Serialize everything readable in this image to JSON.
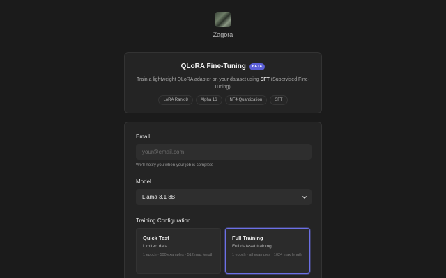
{
  "brand": {
    "name": "Zagora",
    "logo_icon": "zagora-logo-image"
  },
  "intro": {
    "title": "QLoRA Fine-Tuning",
    "badge": "BETA",
    "desc_prefix": "Train a lightweight QLoRA adapter on your dataset using ",
    "desc_strong": "SFT",
    "desc_suffix": " (Supervised Fine-Tuning).",
    "tags": [
      "LoRA Rank 8",
      "Alpha 16",
      "NF4 Quantization",
      "SFT"
    ]
  },
  "form": {
    "email": {
      "label": "Email",
      "placeholder": "your@email.com",
      "value": "",
      "hint": "We'll notify you when your job is complete"
    },
    "model": {
      "label": "Model",
      "selected": "Llama 3.1 8B",
      "chevron_icon": "chevron-down-icon"
    },
    "training": {
      "label": "Training Configuration",
      "options": [
        {
          "title": "Quick Test",
          "subtitle": "Limited data",
          "meta": "1 epoch · 500 examples · 512 max length",
          "selected": false
        },
        {
          "title": "Full Training",
          "subtitle": "Full dataset training",
          "meta": "1 epoch · all examples · 1024 max length",
          "selected": true
        }
      ]
    }
  },
  "colors": {
    "background": "#1b1b1b",
    "card": "#242424",
    "accent": "#6c70e6",
    "badge": "#5b5fd6"
  }
}
